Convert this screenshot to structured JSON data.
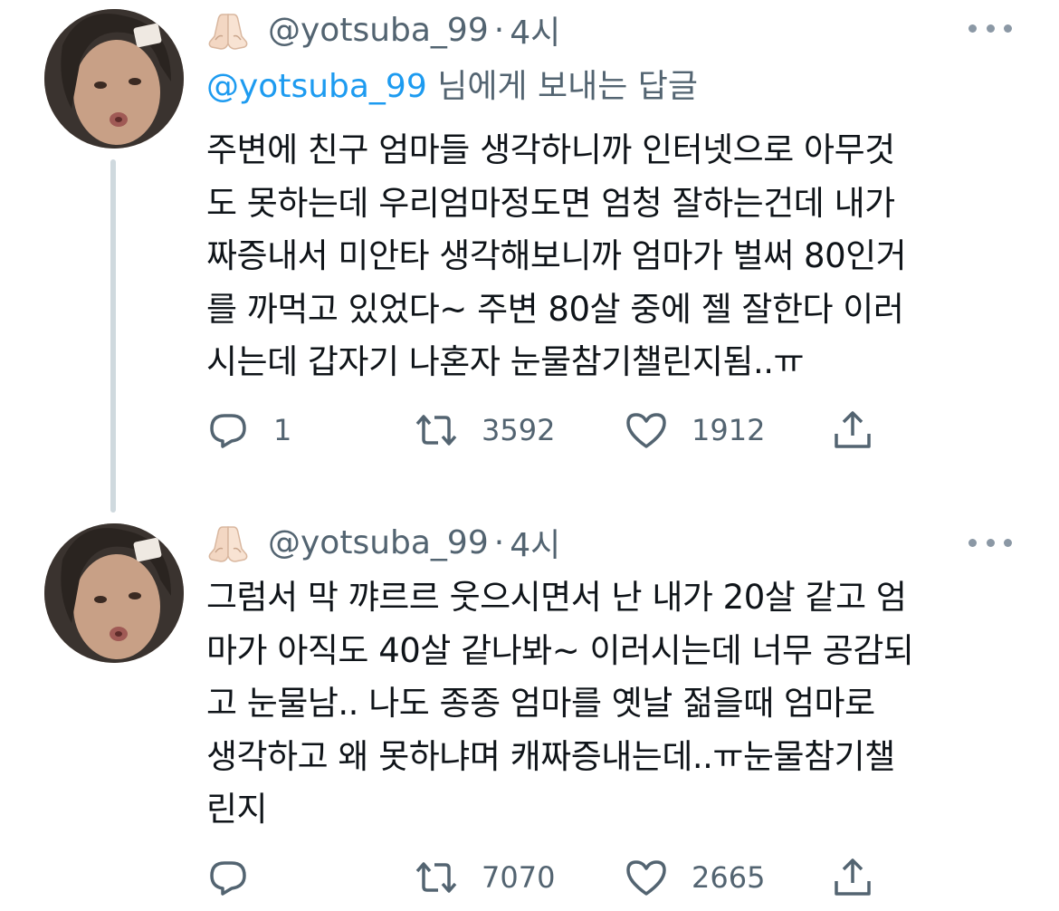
{
  "tweets": [
    {
      "handle": "@yotsuba_99",
      "separator": "·",
      "time": "4시",
      "reply_mention": "@yotsuba_99",
      "reply_suffix": " 님에게 보내는 답글",
      "text": "주변에 친구 엄마들 생각하니까 인터넷으로 아무것\n도 못하는데 우리엄마정도면 엄청 잘하는건데 내가\n짜증내서 미안타 생각해보니까 엄마가 벌써 80인거\n를 까먹고 있었다~ 주변 80살 중에 젤 잘한다 이러\n시는데 갑자기 나혼자 눈물참기챌린지됨..ㅠ",
      "replies": "1",
      "retweets": "3592",
      "likes": "1912"
    },
    {
      "handle": "@yotsuba_99",
      "separator": "·",
      "time": "4시",
      "text": "그럼서 막 꺄르르 웃으시면서 난 내가 20살 같고 엄\n마가 아직도 40살 같나봐~ 이러시는데 너무 공감되\n고 눈물남.. 나도 종종 엄마를 옛날 젊을때 엄마로\n생각하고 왜 못하냐며 캐짜증내는데..ㅠ눈물참기챌\n린지",
      "replies": "",
      "retweets": "7070",
      "likes": "2665"
    }
  ],
  "icons": {
    "name_emoji": "folded-hands-icon",
    "more": "more-dots-icon",
    "reply": "reply-bubble-icon",
    "retweet": "retweet-icon",
    "like": "heart-icon",
    "share": "share-icon"
  },
  "colors": {
    "text": "#0f1419",
    "secondary": "#536471",
    "mention": "#1d9bf0",
    "thread_line": "#cfd9de"
  }
}
